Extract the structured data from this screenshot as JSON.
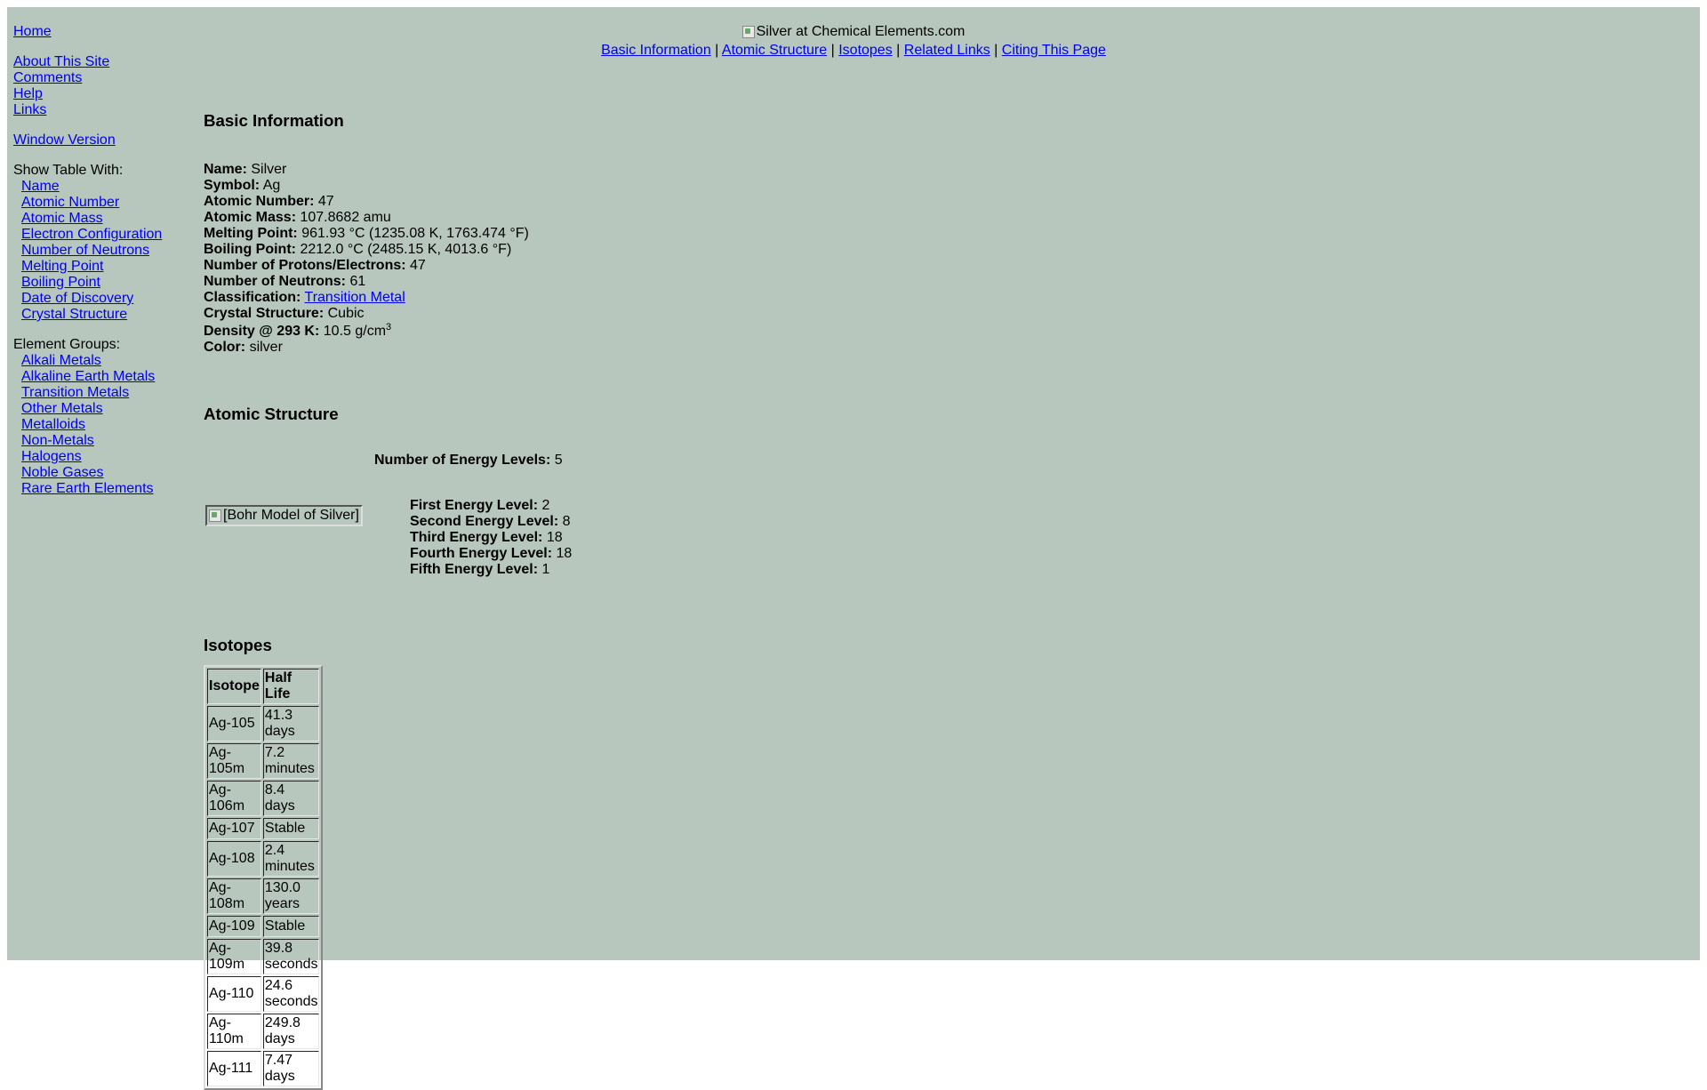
{
  "sidebar": {
    "home": "Home",
    "about": "About This Site",
    "comments": "Comments",
    "help": "Help",
    "links": "Links",
    "window_version": "Window Version",
    "show_table_label": "Show Table With:",
    "show_table": [
      "Name",
      "Atomic Number",
      "Atomic Mass",
      "Electron Configuration",
      "Number of Neutrons",
      "Melting Point",
      "Boiling Point",
      "Date of Discovery",
      "Crystal Structure"
    ],
    "groups_label": "Element Groups:",
    "groups": [
      "Alkali Metals",
      "Alkaline Earth Metals",
      "Transition Metals",
      "Other Metals",
      "Metalloids",
      "Non-Metals",
      "Halogens",
      "Noble Gases",
      "Rare Earth Elements"
    ]
  },
  "header": {
    "logo_alt": "Silver at Chemical Elements.com",
    "nav": [
      "Basic Information",
      "Atomic Structure",
      "Isotopes",
      "Related Links",
      "Citing This Page"
    ],
    "separator": "|"
  },
  "basic": {
    "heading": "Basic Information",
    "name_label": "Name:",
    "name": "Silver",
    "symbol_label": "Symbol:",
    "symbol": "Ag",
    "number_label": "Atomic Number:",
    "number": "47",
    "mass_label": "Atomic Mass:",
    "mass": "107.8682 amu",
    "melting_label": "Melting Point:",
    "melting": "961.93 °C (1235.08 K, 1763.474 °F)",
    "boiling_label": "Boiling Point:",
    "boiling": "2212.0 °C (2485.15 K, 4013.6 °F)",
    "protons_label": "Number of Protons/Electrons:",
    "protons": "47",
    "neutrons_label": "Number of Neutrons:",
    "neutrons": "61",
    "class_label": "Classification:",
    "classification": "Transition Metal",
    "crystal_label": "Crystal Structure:",
    "crystal": "Cubic",
    "density_label": "Density @ 293 K:",
    "density": "10.5 g/cm",
    "density_exp": "3",
    "color_label": "Color:",
    "color": "silver"
  },
  "atomic": {
    "heading": "Atomic Structure",
    "levels_count_label": "Number of Energy Levels:",
    "levels_count": "5",
    "bohr_alt": "[Bohr Model of Silver]",
    "levels": [
      {
        "label": "First Energy Level:",
        "value": "2"
      },
      {
        "label": "Second Energy Level:",
        "value": "8"
      },
      {
        "label": "Third Energy Level:",
        "value": "18"
      },
      {
        "label": "Fourth Energy Level:",
        "value": "18"
      },
      {
        "label": "Fifth Energy Level:",
        "value": "1"
      }
    ]
  },
  "isotopes": {
    "heading": "Isotopes",
    "headers": [
      "Isotope",
      "Half Life"
    ],
    "rows": [
      [
        "Ag-105",
        "41.3 days"
      ],
      [
        "Ag-105m",
        "7.2 minutes"
      ],
      [
        "Ag-106m",
        "8.4 days"
      ],
      [
        "Ag-107",
        "Stable"
      ],
      [
        "Ag-108",
        "2.4 minutes"
      ],
      [
        "Ag-108m",
        "130.0 years"
      ],
      [
        "Ag-109",
        "Stable"
      ],
      [
        "Ag-109m",
        "39.8 seconds"
      ],
      [
        "Ag-110",
        "24.6 seconds"
      ],
      [
        "Ag-110m",
        "249.8 days"
      ],
      [
        "Ag-111",
        "7.47 days"
      ]
    ]
  },
  "colors": {
    "page_background": "#b7c7be",
    "link": "#0000ee"
  }
}
